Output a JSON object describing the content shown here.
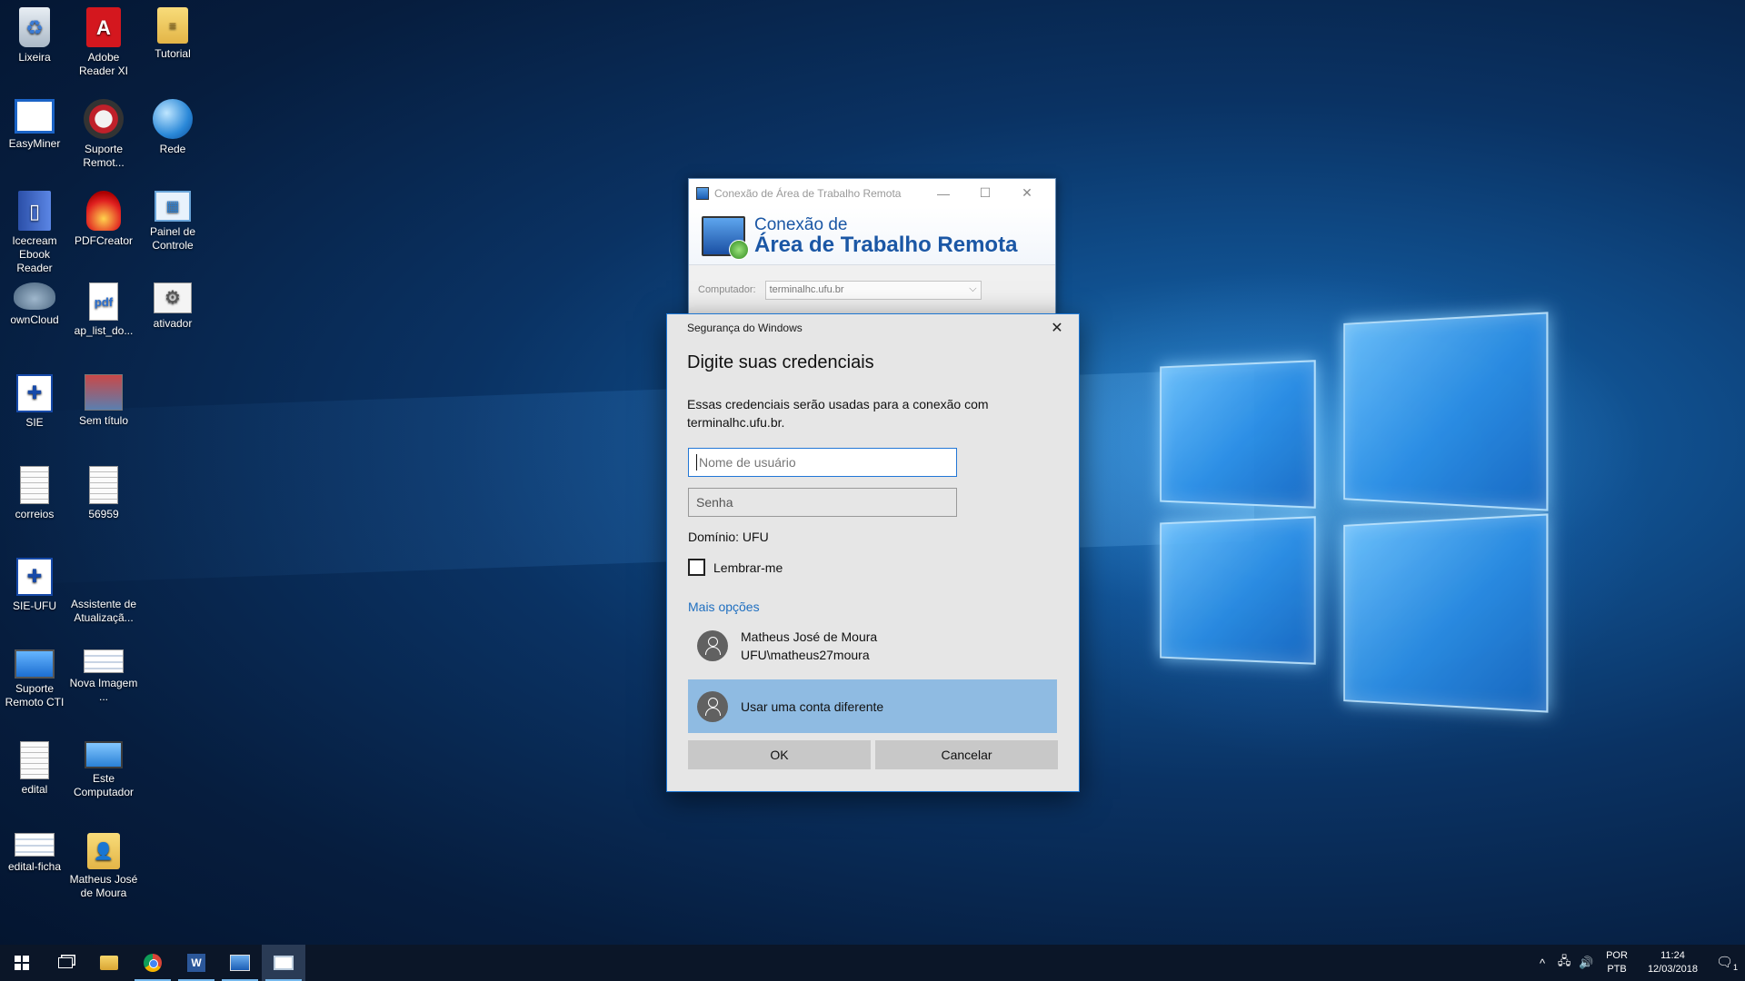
{
  "desktop": {
    "icons": [
      {
        "label": "Lixeira",
        "glyph": "♻"
      },
      {
        "label": "Adobe Reader XI",
        "glyph": "A"
      },
      {
        "label": "Tutorial",
        "glyph": "≡"
      },
      {
        "label": "EasyMiner",
        "glyph": ""
      },
      {
        "label": "Suporte Remot...",
        "glyph": ""
      },
      {
        "label": "Rede",
        "glyph": ""
      },
      {
        "label": "Icecream Ebook Reader",
        "glyph": "▯"
      },
      {
        "label": "PDFCreator",
        "glyph": ""
      },
      {
        "label": "Painel de Controle",
        "glyph": "▦"
      },
      {
        "label": "ownCloud",
        "glyph": ""
      },
      {
        "label": "ap_list_do...",
        "glyph": "pdf"
      },
      {
        "label": "ativador",
        "glyph": "⚙"
      },
      {
        "label": "SIE",
        "glyph": "✚"
      },
      {
        "label": "Sem título",
        "glyph": ""
      },
      {
        "label": "correios",
        "glyph": ""
      },
      {
        "label": "56959",
        "glyph": ""
      },
      {
        "label": "SIE-UFU",
        "glyph": "✚"
      },
      {
        "label": "Assistente de Atualizaçã...",
        "glyph": ""
      },
      {
        "label": "Suporte Remoto CTI",
        "glyph": ""
      },
      {
        "label": "Nova Imagem ...",
        "glyph": ""
      },
      {
        "label": "edital",
        "glyph": ""
      },
      {
        "label": "Este Computador",
        "glyph": ""
      },
      {
        "label": "edital-ficha",
        "glyph": ""
      },
      {
        "label": "Matheus José de Moura",
        "glyph": "👤"
      }
    ]
  },
  "rdp_window": {
    "title": "Conexão de Área de Trabalho Remota",
    "minimize": "—",
    "maximize": "☐",
    "close": "✕",
    "banner_line1": "Conexão de",
    "banner_line2": "Área de Trabalho Remota",
    "computer_label": "Computador:",
    "computer_value": "terminalhc.ufu.br",
    "dropdown_arrow": "⌵"
  },
  "security_dialog": {
    "title": "Segurança do Windows",
    "close": "✕",
    "heading": "Digite suas credenciais",
    "message": "Essas credenciais serão usadas para a conexão com terminalhc.ufu.br.",
    "username_placeholder": "Nome de usuário",
    "password_placeholder": "Senha",
    "domain": "Domínio: UFU",
    "remember_label": "Lembrar-me",
    "more_options": "Mais opções",
    "accounts": [
      {
        "name": "Matheus José de Moura",
        "id": "UFU\\matheus27moura"
      },
      {
        "name": "Usar uma conta diferente",
        "id": ""
      }
    ],
    "ok_label": "OK",
    "cancel_label": "Cancelar"
  },
  "taskbar": {
    "word_glyph": "W",
    "tray_chevron": "^",
    "network_icon": "🖧",
    "volume_icon": "🔊",
    "lang_line1": "POR",
    "lang_line2": "PTB",
    "time": "11:24",
    "date": "12/03/2018",
    "notification_icon": "🗨",
    "notification_count": "1"
  },
  "colors": {
    "accent": "#1e76d2",
    "selected_account": "#8fbbe2",
    "link": "#1f6fc0",
    "taskbar": "#0b1628"
  }
}
